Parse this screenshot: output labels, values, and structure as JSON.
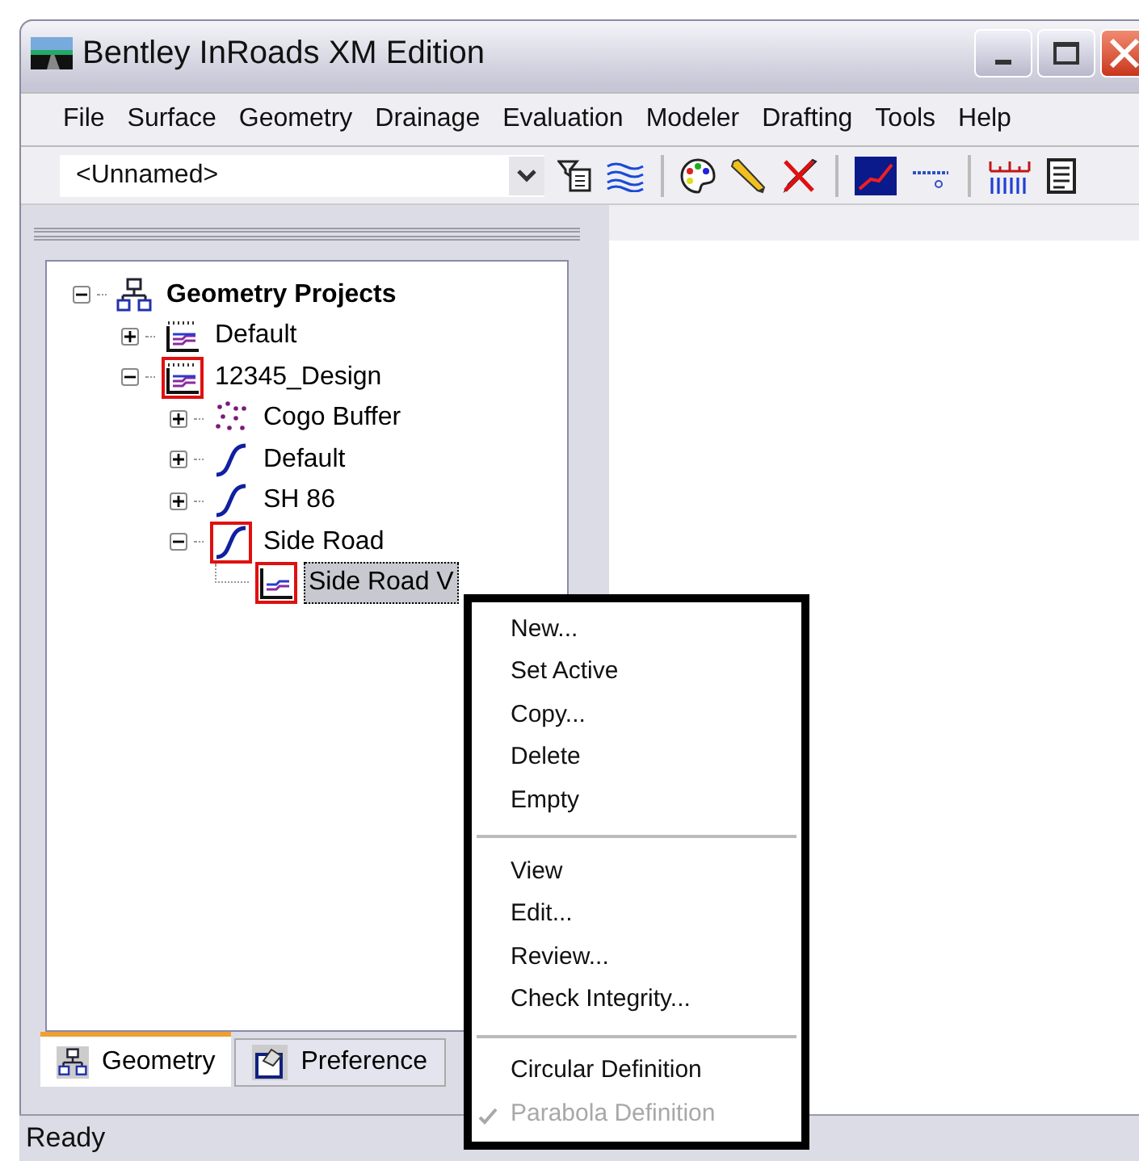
{
  "window": {
    "title": "Bentley InRoads XM Edition"
  },
  "menu": [
    "File",
    "Surface",
    "Geometry",
    "Drainage",
    "Evaluation",
    "Modeler",
    "Drafting",
    "Tools",
    "Help"
  ],
  "toolbar": {
    "combo_value": "<Unnamed>"
  },
  "tree": [
    {
      "label": "Geometry Projects",
      "kind": "root",
      "expanded": true,
      "selected": false,
      "outlined": false,
      "children": [
        {
          "label": "Default",
          "kind": "project",
          "expanded": false,
          "selected": false,
          "outlined": false
        },
        {
          "label": "12345_Design",
          "kind": "project",
          "expanded": true,
          "selected": false,
          "outlined": true,
          "children": [
            {
              "label": "Cogo Buffer",
              "kind": "cogo",
              "expanded": false,
              "selected": false,
              "outlined": false
            },
            {
              "label": "Default",
              "kind": "alignment",
              "expanded": false,
              "selected": false,
              "outlined": false
            },
            {
              "label": "SH 86",
              "kind": "alignment",
              "expanded": false,
              "selected": false,
              "outlined": false
            },
            {
              "label": "Side Road",
              "kind": "alignment",
              "expanded": true,
              "selected": false,
              "outlined": true,
              "children": [
                {
                  "label": "Side Road V",
                  "kind": "profile",
                  "selected": true,
                  "outlined": true
                }
              ]
            }
          ]
        }
      ]
    }
  ],
  "tabs": [
    {
      "label": "Geometry",
      "kind": "geometry",
      "selected": true
    },
    {
      "label": "Preference",
      "kind": "preference",
      "selected": false
    }
  ],
  "context_menu": [
    {
      "kind": "item",
      "label": "New...",
      "disabled": false,
      "checked": false
    },
    {
      "kind": "item",
      "label": "Set Active",
      "disabled": false,
      "checked": false
    },
    {
      "kind": "item",
      "label": "Copy...",
      "disabled": false,
      "checked": false
    },
    {
      "kind": "item",
      "label": "Delete",
      "disabled": false,
      "checked": false
    },
    {
      "kind": "item",
      "label": "Empty",
      "disabled": false,
      "checked": false
    },
    {
      "kind": "separator"
    },
    {
      "kind": "item",
      "label": "View",
      "disabled": false,
      "checked": false
    },
    {
      "kind": "item",
      "label": "Edit...",
      "disabled": false,
      "checked": false
    },
    {
      "kind": "item",
      "label": "Review...",
      "disabled": false,
      "checked": false
    },
    {
      "kind": "item",
      "label": "Check Integrity...",
      "disabled": false,
      "checked": false
    },
    {
      "kind": "separator"
    },
    {
      "kind": "item",
      "label": "Circular Definition",
      "disabled": false,
      "checked": false
    },
    {
      "kind": "item",
      "label": "Parabola Definition",
      "disabled": true,
      "checked": true
    }
  ],
  "status_bar": "Ready"
}
